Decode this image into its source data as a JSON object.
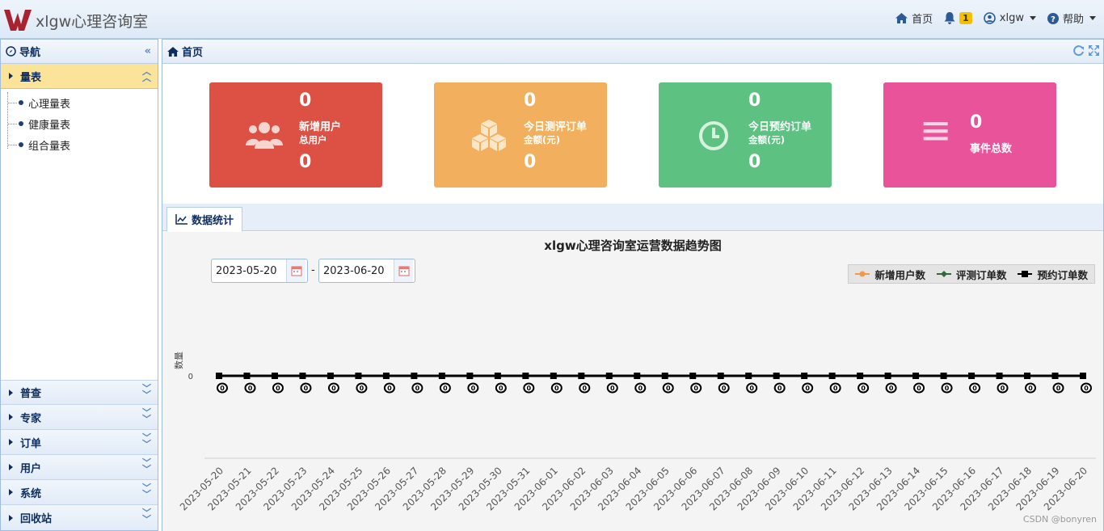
{
  "app": {
    "title": "xlgw心理咨询室",
    "brand_color": "#a8232f"
  },
  "topnav": {
    "home_label": "首页",
    "notification_count": "1",
    "user_label": "xlgw",
    "help_label": "帮助"
  },
  "sidebar": {
    "title": "导航",
    "active_section": {
      "label": "量表",
      "items": [
        "心理量表",
        "健康量表",
        "组合量表"
      ]
    },
    "sections": [
      "普查",
      "专家",
      "订单",
      "用户",
      "系统",
      "回收站"
    ]
  },
  "main": {
    "title": "首页",
    "cards": [
      {
        "color": "#dd5044",
        "icon": "users-icon",
        "value1": "0",
        "label1": "新增用户",
        "label2": "总用户",
        "value2": "0"
      },
      {
        "color": "#f2b05e",
        "icon": "boxes-icon",
        "value1": "0",
        "label1": "今日测评订单",
        "label2": "金额(元)",
        "value2": "0"
      },
      {
        "color": "#5cc181",
        "icon": "clock-icon",
        "value1": "0",
        "label1": "今日预约订单",
        "label2": "金额(元)",
        "value2": "0"
      },
      {
        "color": "#e8539a",
        "icon": "list-icon",
        "value1": "0",
        "label1": "事件总数",
        "label2": "",
        "value2": ""
      }
    ],
    "tab_label": "数据统计",
    "date_from": "2023-05-20",
    "date_separator": "-",
    "date_to": "2023-06-20",
    "watermark": "CSDN @bonyren"
  },
  "chart_data": {
    "type": "line",
    "title": "xlgw心理咨询室运营数据趋势图",
    "ylabel": "数量",
    "xlabel": "",
    "legend_position": "top-right",
    "y_ticks": [
      "0"
    ],
    "categories": [
      "2023-05-20",
      "2023-05-21",
      "2023-05-22",
      "2023-05-23",
      "2023-05-24",
      "2023-05-25",
      "2023-05-26",
      "2023-05-27",
      "2023-05-28",
      "2023-05-29",
      "2023-05-30",
      "2023-05-31",
      "2023-06-01",
      "2023-06-02",
      "2023-06-03",
      "2023-06-04",
      "2023-06-05",
      "2023-06-06",
      "2023-06-07",
      "2023-06-08",
      "2023-06-09",
      "2023-06-10",
      "2023-06-11",
      "2023-06-12",
      "2023-06-13",
      "2023-06-14",
      "2023-06-15",
      "2023-06-16",
      "2023-06-17",
      "2023-06-18",
      "2023-06-19",
      "2023-06-20"
    ],
    "series": [
      {
        "name": "新增用户数",
        "color": "#f29a4a",
        "marker": "circle",
        "values": [
          0,
          0,
          0,
          0,
          0,
          0,
          0,
          0,
          0,
          0,
          0,
          0,
          0,
          0,
          0,
          0,
          0,
          0,
          0,
          0,
          0,
          0,
          0,
          0,
          0,
          0,
          0,
          0,
          0,
          0,
          0,
          0
        ]
      },
      {
        "name": "评测订单数",
        "color": "#2f6b3a",
        "marker": "diamond",
        "values": [
          0,
          0,
          0,
          0,
          0,
          0,
          0,
          0,
          0,
          0,
          0,
          0,
          0,
          0,
          0,
          0,
          0,
          0,
          0,
          0,
          0,
          0,
          0,
          0,
          0,
          0,
          0,
          0,
          0,
          0,
          0,
          0
        ]
      },
      {
        "name": "预约订单数",
        "color": "#000000",
        "marker": "square",
        "values": [
          0,
          0,
          0,
          0,
          0,
          0,
          0,
          0,
          0,
          0,
          0,
          0,
          0,
          0,
          0,
          0,
          0,
          0,
          0,
          0,
          0,
          0,
          0,
          0,
          0,
          0,
          0,
          0,
          0,
          0,
          0,
          0
        ]
      }
    ],
    "data_labels": [
      "0",
      "0",
      "0",
      "0",
      "0",
      "0",
      "0",
      "0",
      "0",
      "0",
      "0",
      "0",
      "0",
      "0",
      "0",
      "0",
      "0",
      "0",
      "0",
      "0",
      "0",
      "0",
      "0",
      "0",
      "0",
      "0",
      "0",
      "0",
      "0",
      "0",
      "0",
      "0"
    ]
  }
}
